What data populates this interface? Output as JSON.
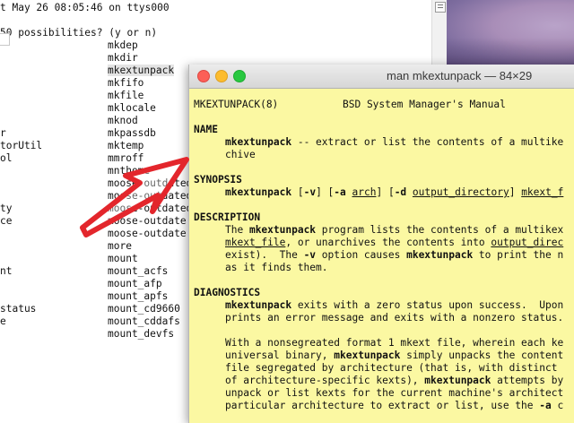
{
  "background_terminal": {
    "header_line": "t May 26 08:05:46 on ttys000",
    "prompt_line": "50 possibilities? (y or n)",
    "left_column": [
      {
        "row": 10,
        "text": "r"
      },
      {
        "row": 11,
        "text": "torUtil"
      },
      {
        "row": 12,
        "text": "ol"
      },
      {
        "row": 16,
        "text": "ty"
      },
      {
        "row": 17,
        "text": "ce"
      },
      {
        "row": 21,
        "text": "nt"
      },
      {
        "row": 24,
        "text": "status"
      },
      {
        "row": 25,
        "text": "e"
      }
    ],
    "commands": [
      "mkdep",
      "mkdir",
      "mkextunpack",
      "mkfifo",
      "mkfile",
      "mklocale",
      "mknod",
      "mkpassdb",
      "mktemp",
      "mmroff",
      "mnthome",
      "moose-outdated",
      "moose-outdated5",
      "moose-outdated",
      "moose-outdate",
      "moose-outdate",
      "more",
      "mount",
      "mount_acfs",
      "mount_afp",
      "mount_apfs",
      "mount_cd9660",
      "mount_cddafs",
      "mount_devfs"
    ],
    "highlighted_command": "mkextunpack"
  },
  "man_window": {
    "title": "man mkextunpack — 84×29",
    "header_left": "MKEXTUNPACK(8)",
    "header_center": "BSD System Manager's Manual",
    "sections": {
      "name_heading": "NAME",
      "name_cmd": "mkextunpack",
      "name_desc": " -- extract or list the contents of a multike",
      "name_desc2": "chive",
      "synopsis_heading": "SYNOPSIS",
      "syn_cmd": "mkextunpack",
      "syn_p1": " [",
      "syn_v": "-v",
      "syn_p2": "] [",
      "syn_a": "-a",
      "syn_sp": " ",
      "syn_arch": "arch",
      "syn_p3": "] [",
      "syn_d": "-d",
      "syn_sp2": " ",
      "syn_outdir": "output_directory",
      "syn_p4": "] ",
      "syn_mkextf": "mkext_f",
      "description_heading": "DESCRIPTION",
      "desc1_pre": "The ",
      "desc1_cmd": "mkextunpack",
      "desc1_post": " program lists the contents of a multikex",
      "desc2_file": "mkext_file",
      "desc2_mid": ", or unarchives the contents into ",
      "desc2_outdir": "output_direc",
      "desc3_pre": "exist).  The ",
      "desc3_v": "-v",
      "desc3_mid": " option causes ",
      "desc3_cmd": "mkextunpack",
      "desc3_post": " to print the n",
      "desc4": "as it finds them.",
      "diagnostics_heading": "DIAGNOSTICS",
      "diag1_cmd": "mkextunpack",
      "diag1_post": " exits with a zero status upon success.  Upon",
      "diag2": "prints an error message and exits with a nonzero status.",
      "diag3": "With a nonsegreated format 1 mkext file, wherein each ke",
      "diag4_pre": "universal binary, ",
      "diag4_cmd": "mkextunpack",
      "diag4_post": " simply unpacks the content",
      "diag5": "file segregated by architecture (that is, with distinct",
      "diag6_pre": "of architecture-specific kexts), ",
      "diag6_cmd": "mkextunpack",
      "diag6_post": " attempts by",
      "diag7": "unpack or list kexts for the current machine's architect",
      "diag8_pre": "particular architecture to extract or list, use the ",
      "diag8_a": "-a",
      "diag8_post": " c"
    }
  },
  "colors": {
    "man_background": "#fbf8a2",
    "arrow": "#e3262c",
    "close": "#fc5f57",
    "minimize": "#fdbc2e",
    "zoom": "#28c840"
  }
}
